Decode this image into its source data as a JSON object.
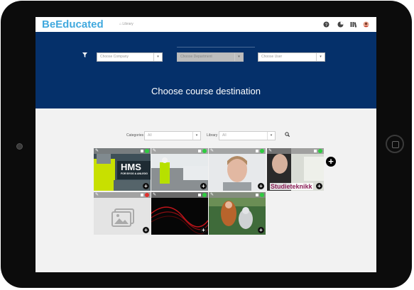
{
  "header": {
    "logo": "BeEducated",
    "breadcrumb": "Library",
    "icons": [
      "help-icon",
      "chart-icon",
      "library-icon",
      "user-avatar"
    ]
  },
  "filters": {
    "company_placeholder": "Choose Company",
    "department_placeholder": "Choose Department",
    "user_placeholder": "Choose User"
  },
  "hero_title": "Choose course destination",
  "search": {
    "categories_label": "Categories",
    "categories_value": "All",
    "library_label": "Library",
    "library_value": "All"
  },
  "courses": [
    {
      "text": "HMS",
      "subtext": "FOR BYGG & ANLEGG",
      "status": "green"
    },
    {
      "text": "",
      "status": "green"
    },
    {
      "text": "",
      "status": "green"
    },
    {
      "text": "Studieteknikk",
      "status": "green"
    },
    {
      "text": "",
      "status": "red"
    },
    {
      "text": "",
      "status": "green"
    },
    {
      "text": "",
      "status": "green"
    }
  ],
  "colors": {
    "brand": "#41a9de",
    "hero": "#05306a",
    "status_green": "#2ecc40",
    "status_red": "#e0312e"
  }
}
